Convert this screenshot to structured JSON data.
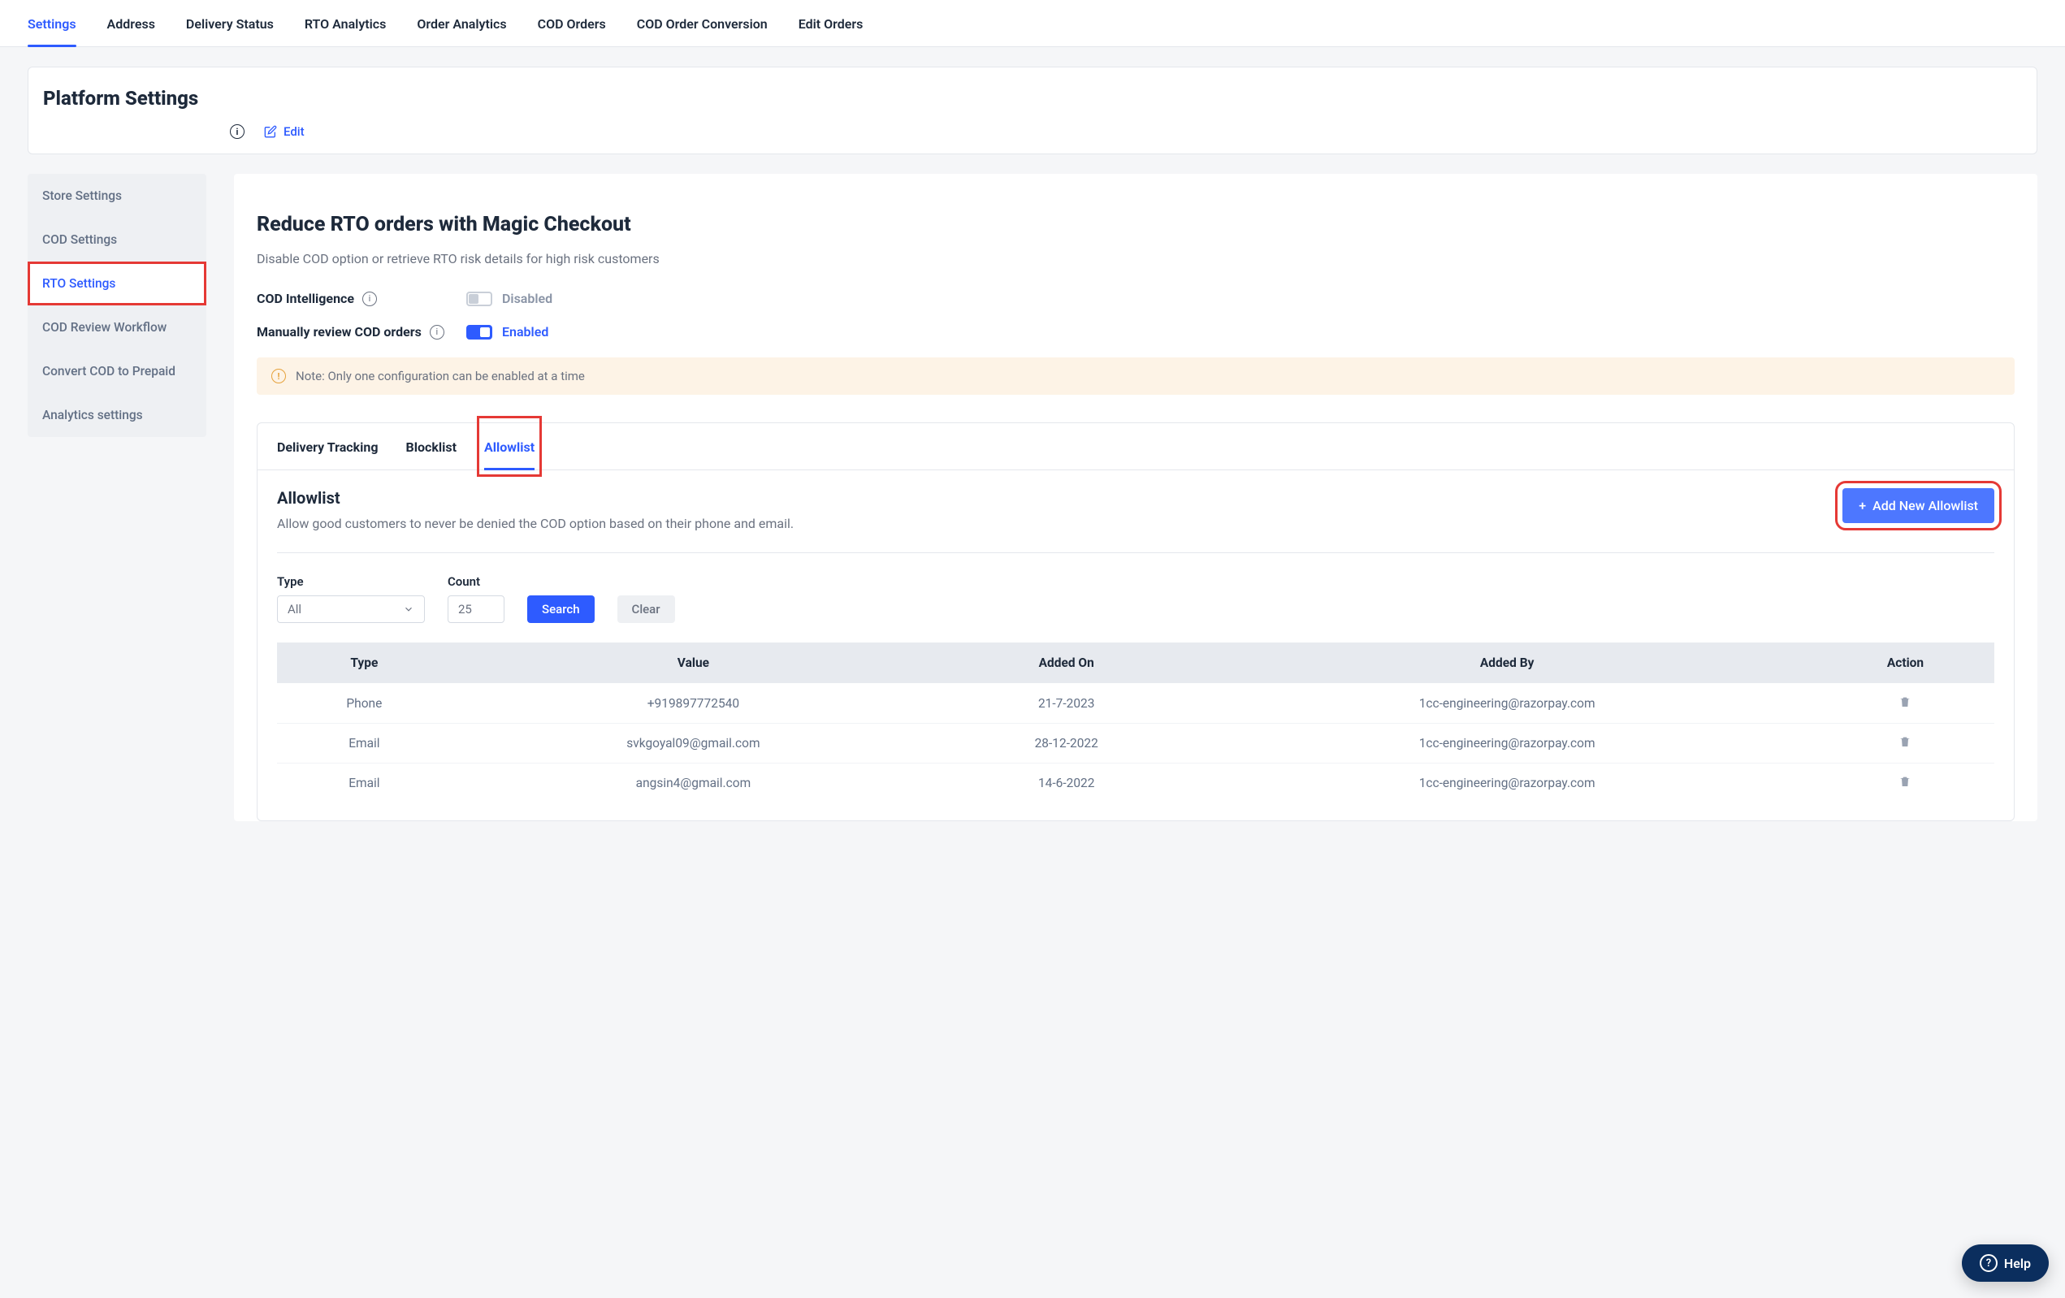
{
  "topnav": {
    "items": [
      "Settings",
      "Address",
      "Delivery Status",
      "RTO Analytics",
      "Order Analytics",
      "COD Orders",
      "COD Order Conversion",
      "Edit Orders"
    ],
    "activeIndex": 0
  },
  "header": {
    "title": "Platform Settings",
    "edit": "Edit"
  },
  "sidebar": {
    "items": [
      "Store Settings",
      "COD Settings",
      "RTO Settings",
      "COD Review Workflow",
      "Convert COD to Prepaid",
      "Analytics settings"
    ],
    "activeIndex": 2
  },
  "main": {
    "title": "Reduce RTO orders with Magic Checkout",
    "desc": "Disable COD option or retrieve RTO risk details for high risk customers",
    "codIntel": {
      "label": "COD Intelligence",
      "state": "Disabled"
    },
    "manualReview": {
      "label": "Manually review COD orders",
      "state": "Enabled"
    },
    "note": "Note: Only one configuration can be enabled at a time"
  },
  "tabs": {
    "items": [
      "Delivery Tracking",
      "Blocklist",
      "Allowlist"
    ],
    "activeIndex": 2
  },
  "allowlist": {
    "title": "Allowlist",
    "desc": "Allow good customers to never be denied the COD option based on their phone and email.",
    "addBtn": "Add New Allowlist",
    "filters": {
      "typeLabel": "Type",
      "typeValue": "All",
      "countLabel": "Count",
      "countValue": "25",
      "search": "Search",
      "clear": "Clear"
    },
    "columns": [
      "Type",
      "Value",
      "Added On",
      "Added By",
      "Action"
    ],
    "rows": [
      {
        "type": "Phone",
        "value": "+919897772540",
        "addedOn": "21-7-2023",
        "addedBy": "1cc-engineering@razorpay.com"
      },
      {
        "type": "Email",
        "value": "svkgoyal09@gmail.com",
        "addedOn": "28-12-2022",
        "addedBy": "1cc-engineering@razorpay.com"
      },
      {
        "type": "Email",
        "value": "angsin4@gmail.com",
        "addedOn": "14-6-2022",
        "addedBy": "1cc-engineering@razorpay.com"
      }
    ]
  },
  "help": "Help"
}
